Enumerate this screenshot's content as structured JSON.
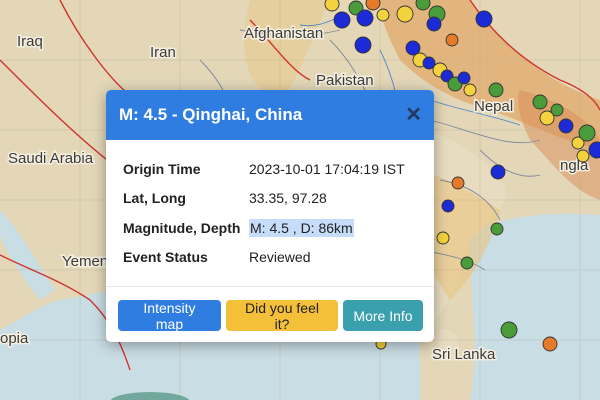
{
  "map": {
    "labels": {
      "iraq": "Iraq",
      "iran": "Iran",
      "afghanistan": "Afghanistan",
      "pakistan": "Pakistan",
      "nepal": "Nepal",
      "saudi_arabia": "Saudi Arabia",
      "yemen": "Yemen",
      "sri_lanka": "Sri Lanka",
      "ethiopia_partial": "opia",
      "bangladesh_partial": "ngla"
    }
  },
  "popup": {
    "title": "M: 4.5 - Qinghai, China",
    "close_label": "✕",
    "header_color": "#2f7de1",
    "fields": [
      {
        "label": "Origin Time",
        "value": "2023-10-01 17:04:19 IST"
      },
      {
        "label": "Lat, Long",
        "value": "33.35, 97.28"
      },
      {
        "label": "Magnitude, Depth",
        "value": "M: 4.5 , D: 86km"
      },
      {
        "label": "Event Status",
        "value": "Reviewed"
      }
    ],
    "buttons": {
      "intensity_map": "Intensity map",
      "did_you_feel_it": "Did you feel it?",
      "more_info": "More Info"
    }
  }
}
